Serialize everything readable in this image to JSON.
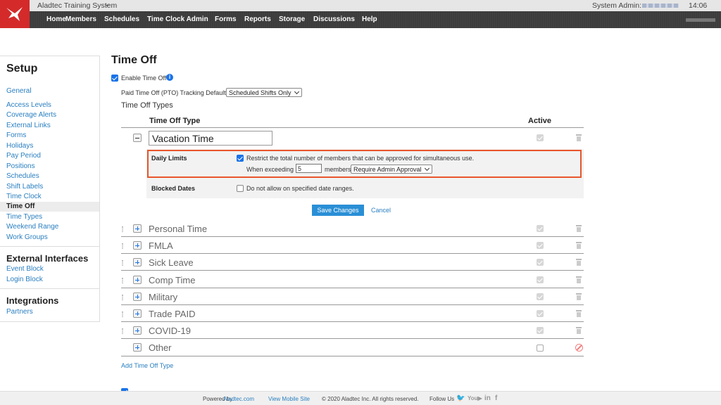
{
  "top": {
    "app_name": "Aladtec Training System",
    "app_chevron": "❯",
    "system_admin": "System Admin:",
    "time": "14:06"
  },
  "nav": [
    "Home",
    "Members",
    "Schedules",
    "Time Clock Admin",
    "Forms",
    "Reports",
    "Storage",
    "Discussions",
    "Help"
  ],
  "sidebar": {
    "setup_title": "Setup",
    "setup_items": [
      "General",
      "Access Levels",
      "Coverage Alerts",
      "External Links",
      "Forms",
      "Holidays",
      "Pay Period",
      "Positions",
      "Schedules",
      "Shift Labels",
      "Time Clock",
      "Time Off",
      "Time Types",
      "Weekend Range",
      "Work Groups"
    ],
    "active_item": "Time Off",
    "external_title": "External Interfaces",
    "external_items": [
      "Event Block",
      "Login Block"
    ],
    "integrations_title": "Integrations",
    "integrations_items": [
      "Partners"
    ]
  },
  "main": {
    "title": "Time Off",
    "enable_label": "Enable Time Off",
    "pto_label": "Paid Time Off (PTO) Tracking Default:",
    "pto_value": "Scheduled Shifts Only",
    "types_label": "Time Off Types",
    "col_type": "Time Off Type",
    "col_active": "Active",
    "expanded": {
      "name": "Vacation Time",
      "daily_limits_label": "Daily Limits",
      "restrict_text": "Restrict the total number of members that can be approved for simultaneous use.",
      "when_exceeding": "When exceeding",
      "exceed_value": "5",
      "members_label": "members",
      "approval_value": "Require Admin Approval",
      "blocked_label": "Blocked Dates",
      "blocked_text": "Do not allow on specified date ranges."
    },
    "save_label": "Save Changes",
    "cancel_label": "Cancel",
    "types": [
      "Personal Time",
      "FMLA",
      "Sick Leave",
      "Comp Time",
      "Military",
      "Trade PAID",
      "COVID-19",
      "Other"
    ],
    "add_label": "Add Time Off Type"
  },
  "footer": {
    "powered_by": "Powered by",
    "powered_link": "Aladtec.com",
    "mobile": "View Mobile Site",
    "copyright": "© 2020 Aladtec Inc. All rights reserved.",
    "follow": "Follow Us"
  },
  "colors": {
    "brand": "#d42a2a",
    "link": "#2a7fc0",
    "highlight": "#e8552b",
    "nav": "#3c3c3c"
  }
}
